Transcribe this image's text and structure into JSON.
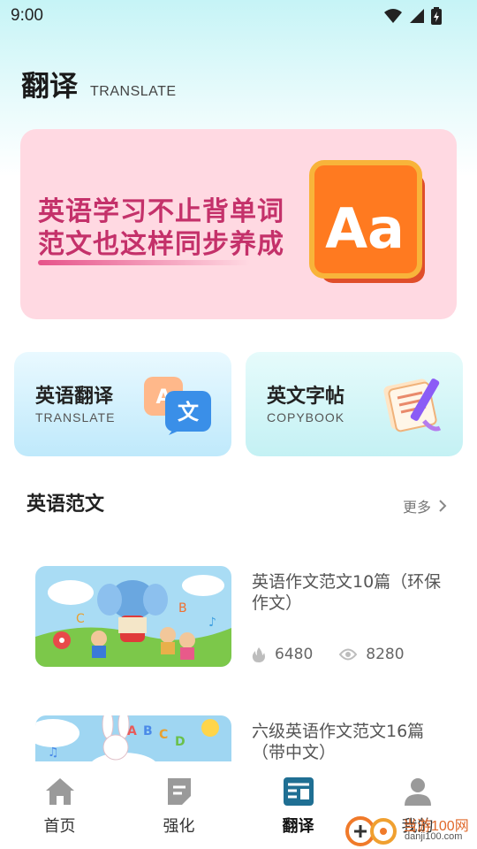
{
  "status_bar": {
    "time": "9:00"
  },
  "header": {
    "title": "翻译",
    "subtitle": "TRANSLATE"
  },
  "banner": {
    "line1": "英语学习不止背单词",
    "line2": "范文也这样同步养成",
    "tile_text": "Aa"
  },
  "cards": [
    {
      "title": "英语翻译",
      "subtitle": "TRANSLATE"
    },
    {
      "title": "英文字帖",
      "subtitle": "COPYBOOK"
    }
  ],
  "section": {
    "title": "英语范文",
    "more_label": "更多"
  },
  "articles": [
    {
      "title": "英语作文范文10篇（环保作文）",
      "likes": "6480",
      "views": "8280"
    },
    {
      "title": "六级英语作文范文16篇（带中文）"
    }
  ],
  "tabs": [
    {
      "label": "首页"
    },
    {
      "label": "强化"
    },
    {
      "label": "翻译"
    },
    {
      "label": "我的"
    }
  ],
  "watermark": {
    "text": "当游100网",
    "url": "danji100.com"
  },
  "colors": {
    "accent_pink": "#c4316a",
    "banner_bg": "#ffd9e2",
    "tab_active": "#1f6f93",
    "tab_inactive": "#9a9a9a"
  }
}
